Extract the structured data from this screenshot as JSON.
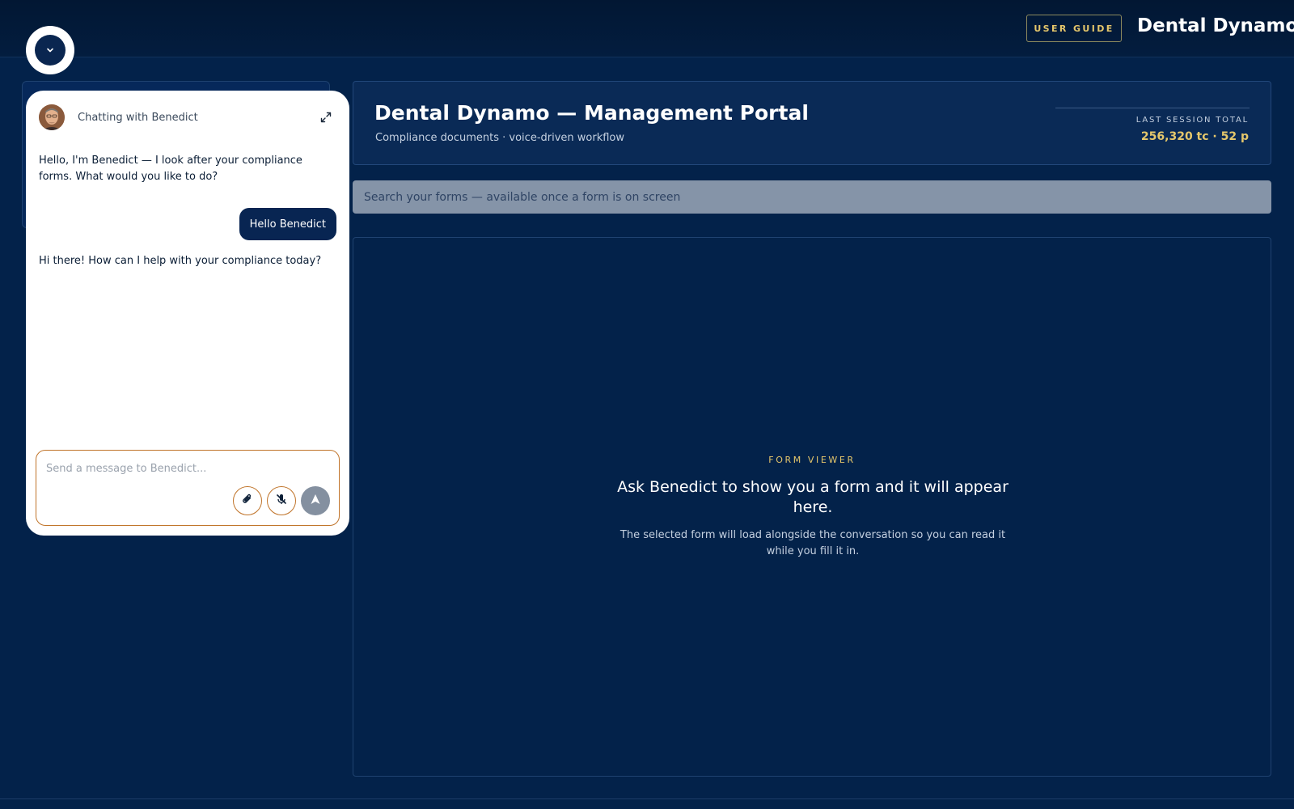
{
  "topbar": {
    "user_guide_label": "USER GUIDE",
    "brand": "Dental Dynamo"
  },
  "chat": {
    "title_prefix": "Chatting with ",
    "agent_name": "Benedict",
    "messages": [
      {
        "role": "bot",
        "text": "Hello, I'm Benedict — I look after your compliance forms. What would you like to do?"
      },
      {
        "role": "user",
        "text": "Hello Benedict"
      },
      {
        "role": "bot",
        "text": "Hi there! How can I help with your compliance today?"
      }
    ],
    "input_placeholder": "Send a message to Benedict..."
  },
  "header": {
    "title": "Dental Dynamo — Management Portal",
    "subtitle": "Compliance documents · voice-driven workflow",
    "session_label": "LAST SESSION TOTAL",
    "session_value": "256,320 tc · 52 p"
  },
  "search": {
    "placeholder": "Search your forms — available once a form is on screen"
  },
  "viewer": {
    "eyebrow": "FORM VIEWER",
    "heading": "Ask Benedict to show you a form and it will appear here.",
    "body": "The selected form will load alongside the conversation so you can read it while you fill it in."
  },
  "colors": {
    "background": "#03224a",
    "accent_gold": "#e5c76b",
    "composer_border": "#c0742a",
    "user_bubble": "#082552"
  },
  "icons": {
    "toggle": "chevron-down-icon",
    "expand": "expand-icon",
    "attach": "paperclip-icon",
    "mic": "mic-off-icon",
    "send": "send-icon"
  }
}
